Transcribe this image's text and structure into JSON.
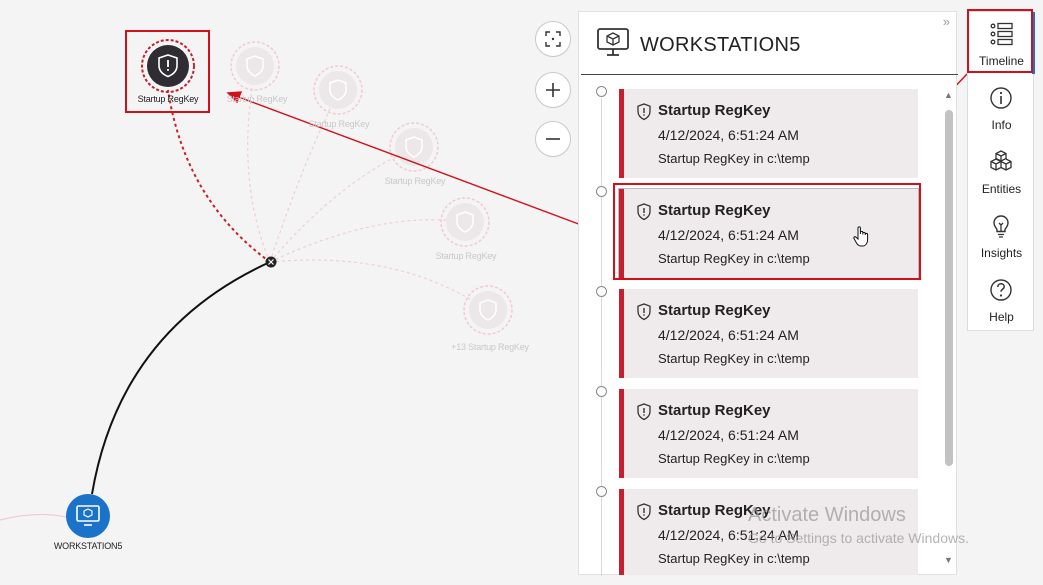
{
  "graph": {
    "root_node_label": "WORKSTATION5",
    "selected_node_label": "Startup RegKey",
    "faded_nodes": [
      {
        "label": "Startup RegKey"
      },
      {
        "label": "Startup RegKey"
      },
      {
        "label": "Startup RegKey"
      },
      {
        "label": "Startup RegKey"
      },
      {
        "label": "+13 Startup RegKey"
      }
    ]
  },
  "zoom_controls": {
    "fit_icon": "fit-to-screen-icon",
    "zoom_in_icon": "plus-icon",
    "zoom_out_icon": "minus-icon"
  },
  "panel": {
    "title": "WORKSTATION5",
    "collapse_glyph": "»",
    "events": [
      {
        "title": "Startup RegKey",
        "time": "4/12/2024, 6:51:24 AM",
        "desc": "Startup RegKey in c:\\temp"
      },
      {
        "title": "Startup RegKey",
        "time": "4/12/2024, 6:51:24 AM",
        "desc": "Startup RegKey in c:\\temp"
      },
      {
        "title": "Startup RegKey",
        "time": "4/12/2024, 6:51:24 AM",
        "desc": "Startup RegKey in c:\\temp"
      },
      {
        "title": "Startup RegKey",
        "time": "4/12/2024, 6:51:24 AM",
        "desc": "Startup RegKey in c:\\temp"
      },
      {
        "title": "Startup RegKey",
        "time": "4/12/2024, 6:51:24 AM",
        "desc": "Startup RegKey in c:\\temp"
      }
    ]
  },
  "sidebar": {
    "items": [
      {
        "label": "Timeline",
        "icon": "timeline-icon"
      },
      {
        "label": "Info",
        "icon": "info-icon"
      },
      {
        "label": "Entities",
        "icon": "cubes-icon"
      },
      {
        "label": "Insights",
        "icon": "lightbulb-icon"
      },
      {
        "label": "Help",
        "icon": "help-icon"
      }
    ]
  },
  "watermark": {
    "title": "Activate Windows",
    "subtitle": "Go to Settings to activate Windows."
  },
  "colors": {
    "accent_red": "#c62030",
    "highlight_red": "#d0101c",
    "root_node_blue": "#1a73c8"
  }
}
